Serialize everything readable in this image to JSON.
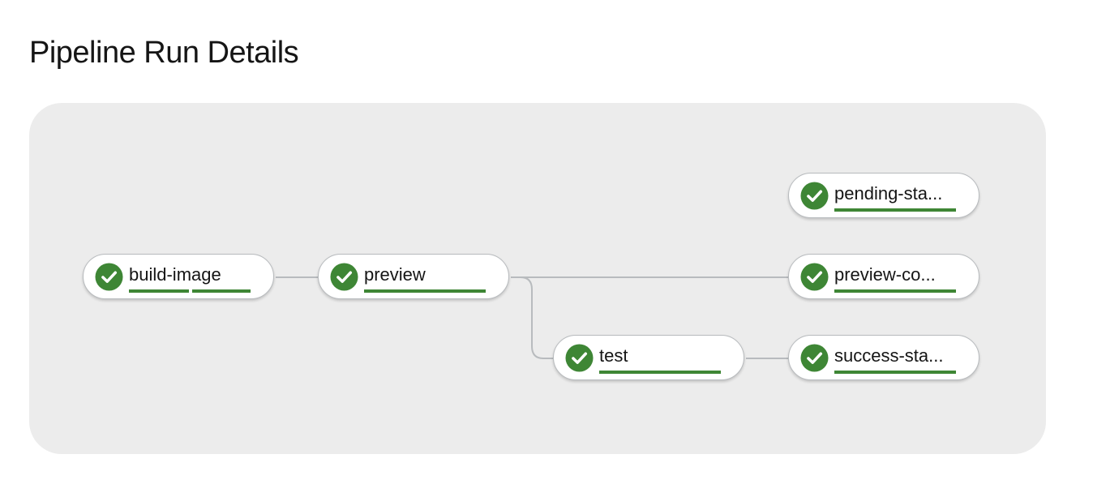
{
  "page": {
    "title": "Pipeline Run Details"
  },
  "colors": {
    "success": "#3e8635",
    "panel_background": "#ececec",
    "edge": "#b8bbbe"
  },
  "tasks": {
    "build_image": {
      "label": "build-image",
      "status": "succeeded",
      "icon": "check-circle-icon"
    },
    "preview": {
      "label": "preview",
      "status": "succeeded",
      "icon": "check-circle-icon"
    },
    "test": {
      "label": "test",
      "status": "succeeded",
      "icon": "check-circle-icon"
    },
    "pending_status": {
      "label": "pending-sta...",
      "status": "succeeded",
      "icon": "check-circle-icon"
    },
    "preview_comment": {
      "label": "preview-co...",
      "status": "succeeded",
      "icon": "check-circle-icon"
    },
    "success_status": {
      "label": "success-sta...",
      "status": "succeeded",
      "icon": "check-circle-icon"
    }
  }
}
